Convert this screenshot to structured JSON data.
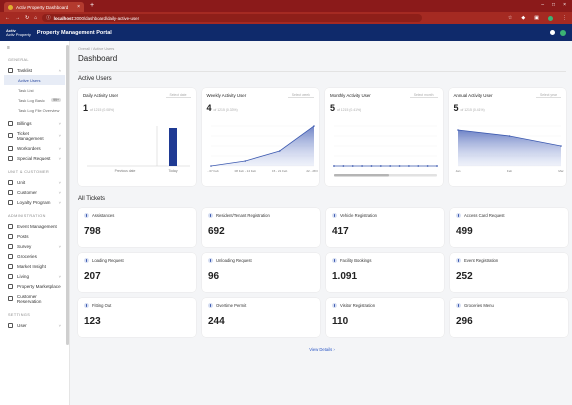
{
  "browser": {
    "tab_title": "Activ Property Dashboard",
    "url_host": "localhost",
    "url_path": ":3000/dashboard/daily-active-user"
  },
  "app": {
    "logo_top": "Activ",
    "logo_bottom": "Activ Property",
    "title": "Property Management Portal"
  },
  "sidebar": {
    "sections": {
      "general": "GENERAL",
      "unit": "UNIT & CUSTOMER",
      "admin": "ADMINISTRATION",
      "settings": "SETTINGS"
    },
    "tasklist": "Tasklist",
    "tasklist_sub": [
      "Active Users",
      "Task List",
      "Task Log Basic",
      "Task Log File Overview"
    ],
    "badge": "99+",
    "general": [
      "Billings",
      "Ticket Management",
      "Workorders",
      "Special Request"
    ],
    "unit": [
      "Unit",
      "Customer",
      "Loyalty Program"
    ],
    "admin": [
      "Event Management",
      "Posts",
      "Survey",
      "Groceries",
      "Market Insight",
      "Living",
      "Property Marketplace",
      "Customer Reservation"
    ],
    "settings": [
      "User"
    ]
  },
  "main": {
    "breadcrumb": "Overall  /  Active Users",
    "title": "Dashboard",
    "active_users_title": "Active Users",
    "all_tickets_title": "All Tickets",
    "view_details": "View Details  ›"
  },
  "cards": [
    {
      "title": "Daily Activity User",
      "select": "Select date",
      "value": "1",
      "pct": "of 1215 (0.08%)"
    },
    {
      "title": "Weekly Activity User",
      "select": "Select week",
      "value": "4",
      "pct": "of 1215 (0.33%)"
    },
    {
      "title": "Monthly Activity User",
      "select": "Select month",
      "value": "5",
      "pct": "of 1215 (0.41%)"
    },
    {
      "title": "Annual Activity User",
      "select": "Select year",
      "value": "5",
      "pct": "of 1215 (0.41%)"
    }
  ],
  "chart_data": [
    {
      "type": "bar",
      "title": "Daily Activity User",
      "categories": [
        "Previous date",
        "Today"
      ],
      "values": [
        0,
        1
      ]
    },
    {
      "type": "area",
      "title": "Weekly Activity User",
      "categories": [
        "01 - 07 Feb",
        "08 Feb - 14 Feb",
        "15 - 21 Feb",
        "22 - 28 Feb"
      ],
      "values": [
        0,
        0.5,
        1.5,
        4
      ]
    },
    {
      "type": "line",
      "title": "Monthly Activity User",
      "values": [
        0,
        0,
        0,
        0,
        0,
        0,
        0,
        0,
        0,
        0,
        0,
        0
      ]
    },
    {
      "type": "area",
      "title": "Annual Activity User",
      "categories": [
        "Jan",
        "Feb",
        "Mar"
      ],
      "values": [
        9,
        7.5,
        5
      ]
    }
  ],
  "tickets": [
    {
      "label": "Assistances",
      "value": "798"
    },
    {
      "label": "Resident/Tenant Registration",
      "value": "692"
    },
    {
      "label": "Vehicle Registration",
      "value": "417"
    },
    {
      "label": "Access Card Request",
      "value": "499"
    },
    {
      "label": "Loading Request",
      "value": "207"
    },
    {
      "label": "Unloading Request",
      "value": "96"
    },
    {
      "label": "Facility Bookings",
      "value": "1.091"
    },
    {
      "label": "Event Registration",
      "value": "252"
    },
    {
      "label": "Fitting Out",
      "value": "123"
    },
    {
      "label": "Overtime Permit",
      "value": "244"
    },
    {
      "label": "Visitor Registration",
      "value": "110"
    },
    {
      "label": "Groceries Menu",
      "value": "296"
    }
  ],
  "colors": {
    "brand": "#0f2a6b",
    "chrome": "#8b1a1a",
    "accent": "#2b4aa0"
  }
}
